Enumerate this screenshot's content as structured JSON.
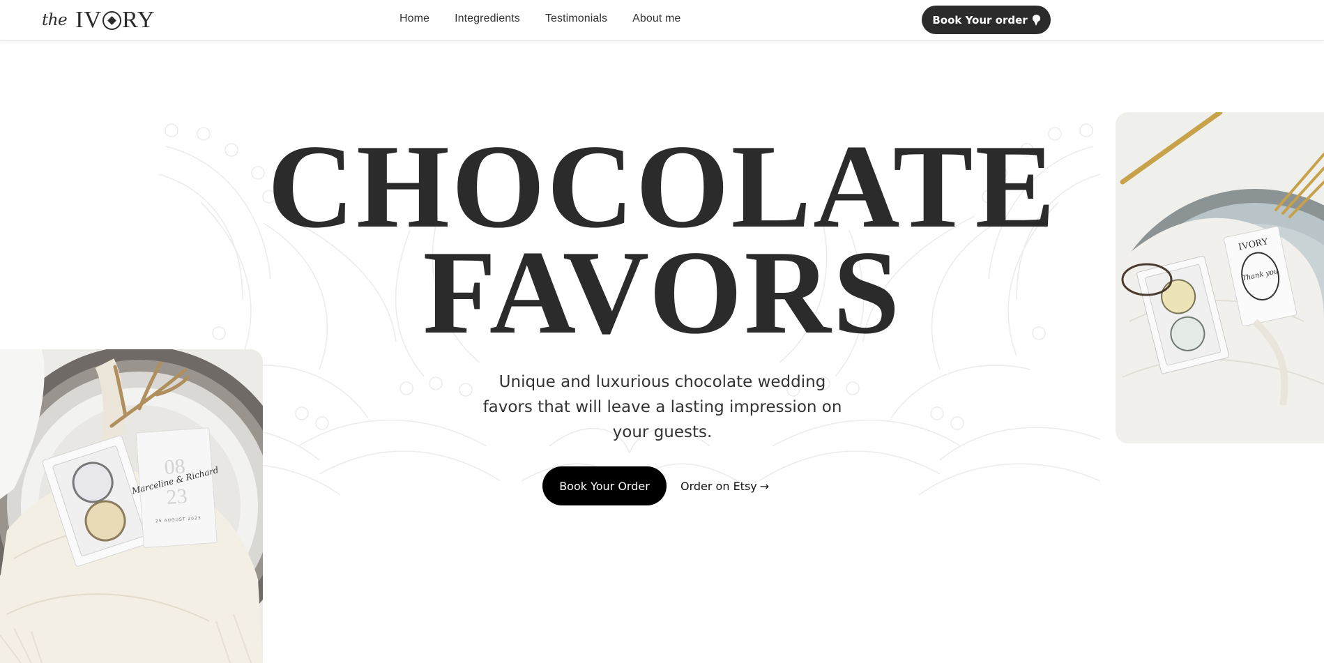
{
  "header": {
    "logo_prefix": "the",
    "logo_word_start": "IV",
    "logo_word_end": "RY",
    "nav": [
      "Home",
      "Integredients",
      "Testimonials",
      "About me"
    ],
    "cta_label": "Book Your order",
    "cta_icon": "ice-cream-icon"
  },
  "hero": {
    "title_line1": "CHOCOLATE",
    "title_line2": "FAVORS",
    "subtitle": "Unique and luxurious chocolate wedding favors that will leave a lasting impression on your guests.",
    "primary_button": "Book Your Order",
    "secondary_link": "Order on Etsy",
    "secondary_arrow": "→"
  },
  "photos": {
    "left": {
      "card_names": "Marceline & Richard",
      "card_date_top": "08",
      "card_date_bottom": "23",
      "card_caption": "25 AUGUST 2023"
    },
    "right": {
      "card_text": "Thank you",
      "box_label": "IVORY"
    }
  },
  "colors": {
    "text": "#2b2b2b",
    "button_dark": "#2b2b2b",
    "button_black": "#000000",
    "background": "#ffffff"
  }
}
